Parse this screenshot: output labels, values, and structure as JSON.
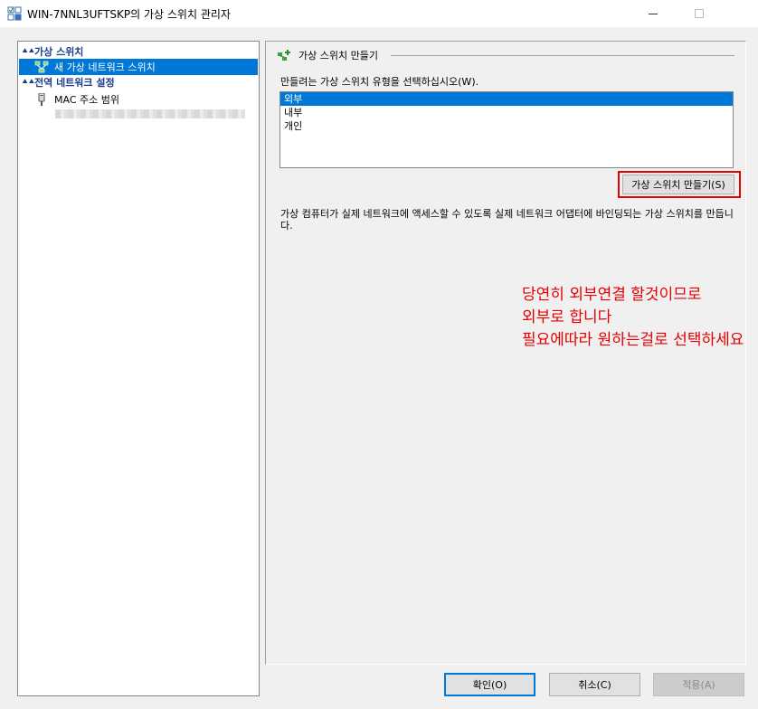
{
  "window": {
    "title": "WIN-7NNL3UFTSKP의 가상 스위치 관리자"
  },
  "sidebar": {
    "sections": [
      {
        "label": "가상 스위치",
        "items": [
          {
            "label": "새 가상 네트워크 스위치",
            "icon": "network-switch-icon",
            "selected": true
          }
        ]
      },
      {
        "label": "전역 네트워크 설정",
        "items": [
          {
            "label": "MAC 주소 범위",
            "icon": "network-adapter-icon",
            "selected": false
          }
        ]
      }
    ]
  },
  "main": {
    "group_title": "가상 스위치 만들기",
    "prompt": "만들려는 가상 스위치 유형을 선택하십시오(W).",
    "switch_types": [
      "외부",
      "내부",
      "개인"
    ],
    "selected_type": "외부",
    "create_button": "가상 스위치 만들기(S)",
    "description": "가상 컴퓨터가 실제 네트워크에 액세스할 수 있도록 실제 네트워크 어댑터에 바인딩되는 가상 스위치를 만듭니다."
  },
  "annotation": {
    "line1": "당연히 외부연결 할것이므로",
    "line2": "외부로 합니다",
    "line3": "필요에따라 원하는걸로 선택하세요",
    "color": "#e60000"
  },
  "footer": {
    "ok": "확인(O)",
    "cancel": "취소(C)",
    "apply": "적용(A)"
  },
  "colors": {
    "selection": "#0078d7",
    "category_text": "#1a3e8c",
    "highlight_frame": "#e60000"
  }
}
